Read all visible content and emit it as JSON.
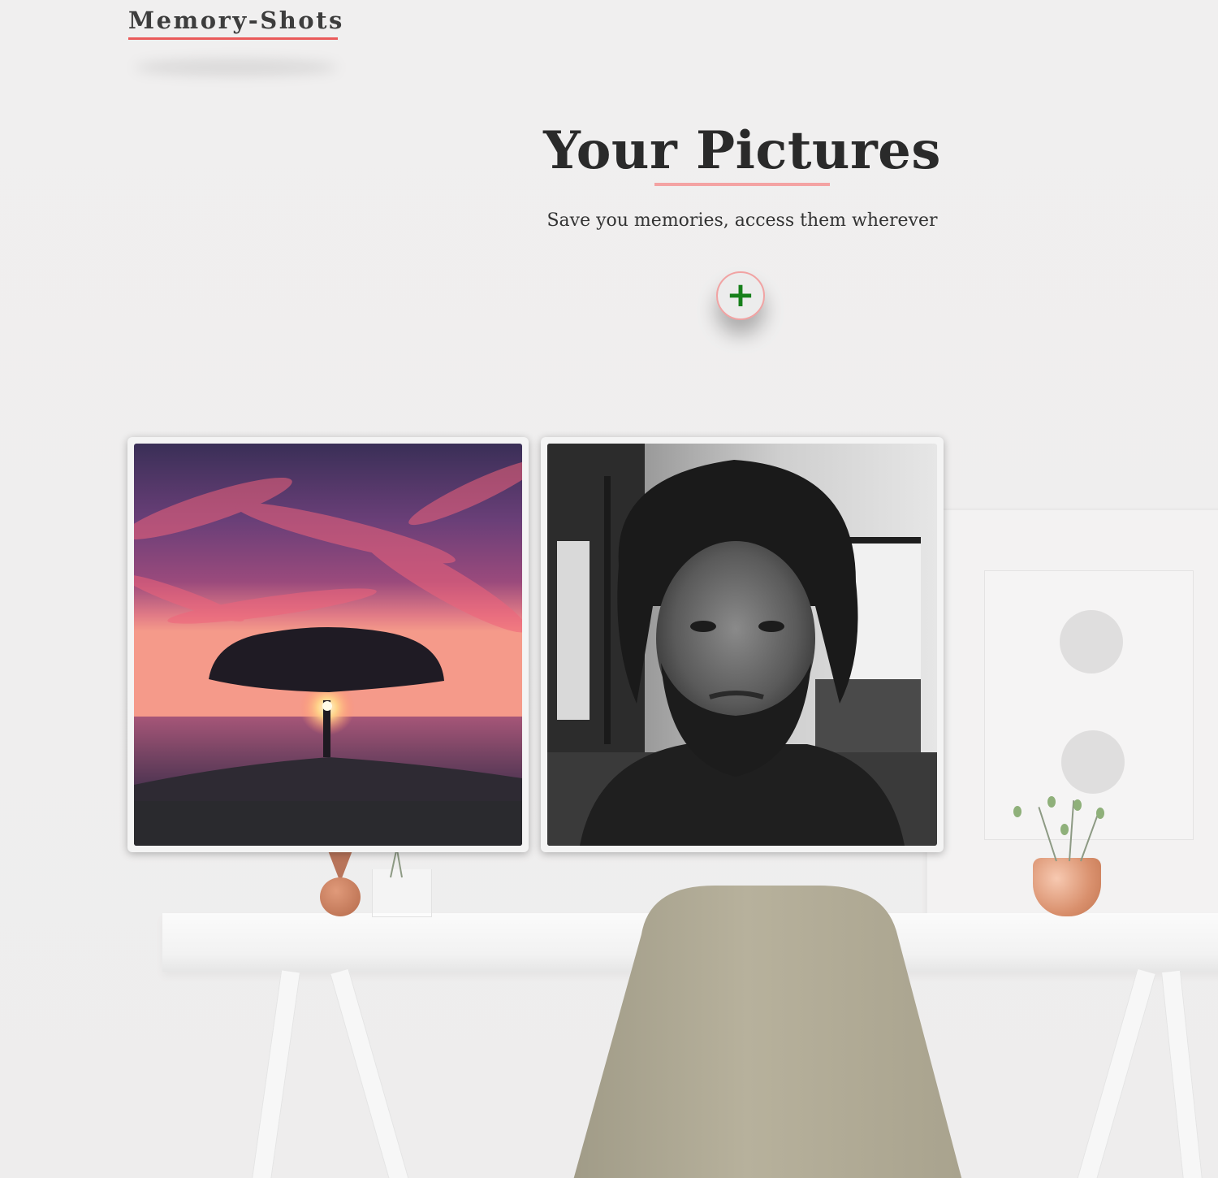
{
  "brand": {
    "name": "Memory-Shots"
  },
  "hero": {
    "title": "Your Pictures",
    "subtitle": "Save you memories, access them wherever"
  },
  "add_button": {
    "icon": "plus-icon",
    "symbol": "+"
  },
  "gallery": {
    "items": [
      {
        "subject": "tree at sunset by the sea"
      },
      {
        "subject": "black and white portrait of a man"
      }
    ]
  },
  "colors": {
    "accent": "#ea5a5a",
    "title_underline": "#f4a3a3",
    "add_icon": "#17801b",
    "text": "#2a2a2a"
  }
}
